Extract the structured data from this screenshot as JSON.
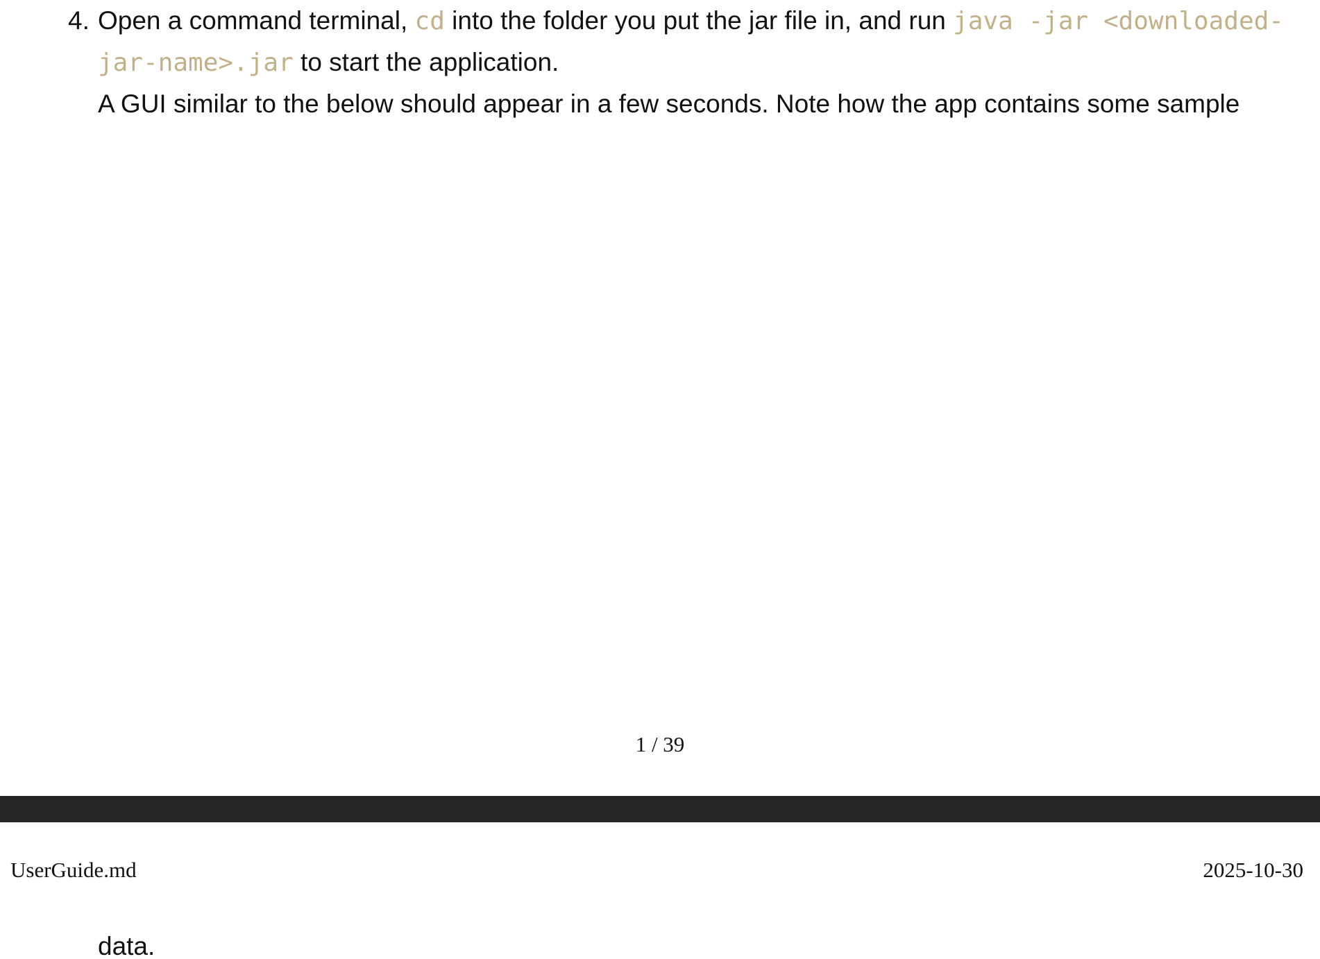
{
  "step": {
    "number": "4.",
    "text_1": "Open a command terminal, ",
    "code_1": "cd",
    "text_2": " into the folder you put the jar file in, and run ",
    "code_2": "java -jar <downloaded-jar-name>.jar",
    "text_3": " to start the application.",
    "paragraph": "A GUI similar to the below should appear in a few seconds. Note how the app contains some sample"
  },
  "footer": {
    "page_number": "1 / 39"
  },
  "next_page": {
    "header_left": "UserGuide.md",
    "header_right": "2025-10-30",
    "continued_text": "data."
  },
  "colors": {
    "code_text": "#c2b088",
    "page_break_bar": "#262626",
    "body_text": "#111111"
  }
}
